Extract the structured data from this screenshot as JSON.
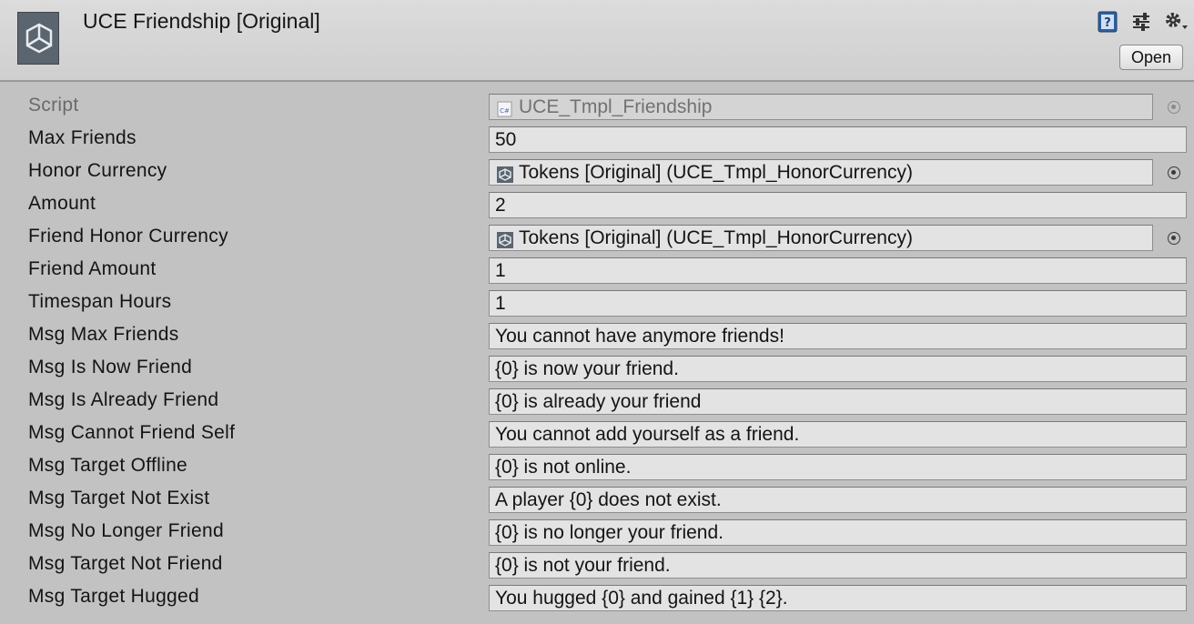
{
  "header": {
    "title": "UCE Friendship [Original]",
    "open_label": "Open",
    "icons": [
      "unity-logo-icon",
      "help-book-icon",
      "preset-sliders-icon",
      "gear-dropdown-icon"
    ]
  },
  "fields": [
    {
      "label": "Script",
      "value": "UCE_Tmpl_Friendship",
      "kind": "script",
      "disabled": true
    },
    {
      "label": "Max Friends",
      "value": "50",
      "kind": "text"
    },
    {
      "label": "Honor Currency",
      "value": "Tokens [Original] (UCE_Tmpl_HonorCurrency)",
      "kind": "object"
    },
    {
      "label": "Amount",
      "value": "2",
      "kind": "text"
    },
    {
      "label": "Friend Honor Currency",
      "value": "Tokens [Original] (UCE_Tmpl_HonorCurrency)",
      "kind": "object"
    },
    {
      "label": "Friend Amount",
      "value": "1",
      "kind": "text"
    },
    {
      "label": "Timespan Hours",
      "value": "1",
      "kind": "text"
    },
    {
      "label": "Msg Max Friends",
      "value": "You cannot have anymore friends!",
      "kind": "text"
    },
    {
      "label": "Msg Is Now Friend",
      "value": "{0} is now your friend.",
      "kind": "text"
    },
    {
      "label": "Msg Is Already Friend",
      "value": "{0} is already your friend",
      "kind": "text"
    },
    {
      "label": "Msg Cannot Friend Self",
      "value": "You cannot add yourself as a friend.",
      "kind": "text"
    },
    {
      "label": "Msg Target Offline",
      "value": "{0} is not online.",
      "kind": "text"
    },
    {
      "label": "Msg Target Not Exist",
      "value": "A player {0} does not exist.",
      "kind": "text"
    },
    {
      "label": "Msg No Longer Friend",
      "value": "{0} is no longer your friend.",
      "kind": "text"
    },
    {
      "label": "Msg Target Not Friend",
      "value": "{0} is not your friend.",
      "kind": "text"
    },
    {
      "label": "Msg Target Hugged",
      "value": "You hugged {0} and gained {1} {2}.",
      "kind": "text"
    }
  ],
  "colors": {
    "background": "#c2c2c2",
    "header": "#d6d6d6",
    "field": "#e3e3e3",
    "disabled_text": "#6a6a6a"
  }
}
